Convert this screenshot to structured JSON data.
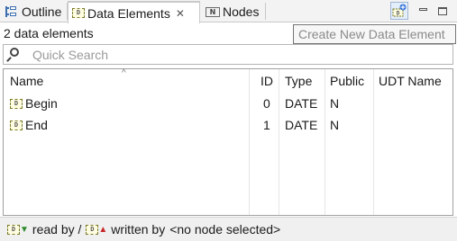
{
  "tabs": {
    "outline": "Outline",
    "data_elements": "Data Elements",
    "nodes": "Nodes"
  },
  "tooltip": "Create New Data Element",
  "count_label": "2 data elements",
  "search": {
    "placeholder": "Quick Search",
    "value": ""
  },
  "table": {
    "columns": [
      "Name",
      "ID",
      "Type",
      "Public",
      "UDT Name"
    ],
    "rows": [
      {
        "name": "Begin",
        "id": "0",
        "type": "DATE",
        "public": "N",
        "udt": ""
      },
      {
        "name": "End",
        "id": "1",
        "type": "DATE",
        "public": "N",
        "udt": ""
      }
    ]
  },
  "status": {
    "read_by": "read by /",
    "written_by": "written by",
    "selection": "<no node selected>"
  },
  "icons": {
    "data_element": "D",
    "node": "N"
  }
}
